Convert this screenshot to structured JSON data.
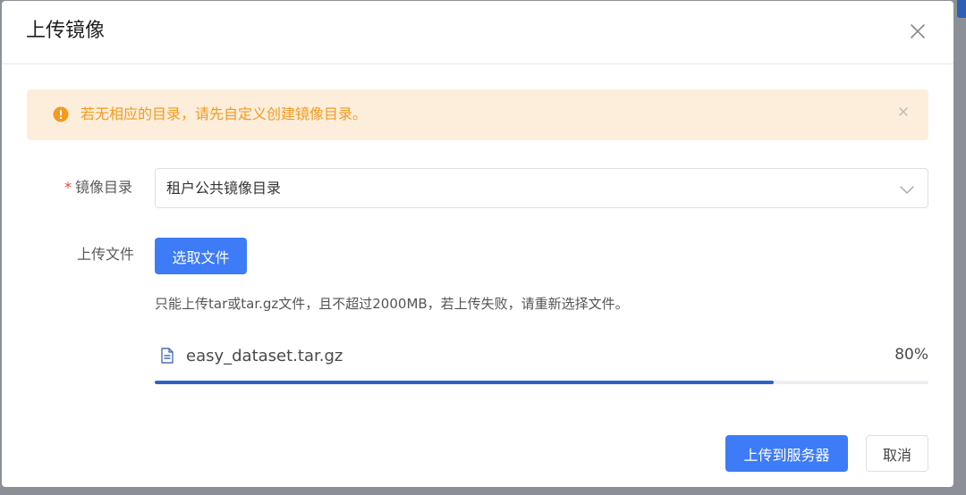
{
  "dialog": {
    "title": "上传镜像",
    "close_icon": "close-icon"
  },
  "alert": {
    "icon": "warning-circle-icon",
    "text": "若无相应的目录，请先自定义创建镜像目录。",
    "close_icon": "close-icon",
    "color": "#f19b21",
    "background": "#fdeedb"
  },
  "form": {
    "directory": {
      "required_mark": "*",
      "label": "镜像目录",
      "selected": "租户公共镜像目录",
      "chevron_icon": "chevron-down-icon"
    },
    "upload": {
      "label": "上传文件",
      "choose_button": "选取文件",
      "hint": "只能上传tar或tar.gz文件，且不超过2000MB，若上传失败，请重新选择文件。"
    },
    "file": {
      "icon": "document-icon",
      "name": "easy_dataset.tar.gz",
      "progress_percent": 80,
      "progress_label": "80%"
    }
  },
  "footer": {
    "upload_button": "上传到服务器",
    "cancel_button": "取消"
  },
  "colors": {
    "primary": "#3d7bf7",
    "progress": "#2f62c9",
    "required": "#f2453d"
  }
}
